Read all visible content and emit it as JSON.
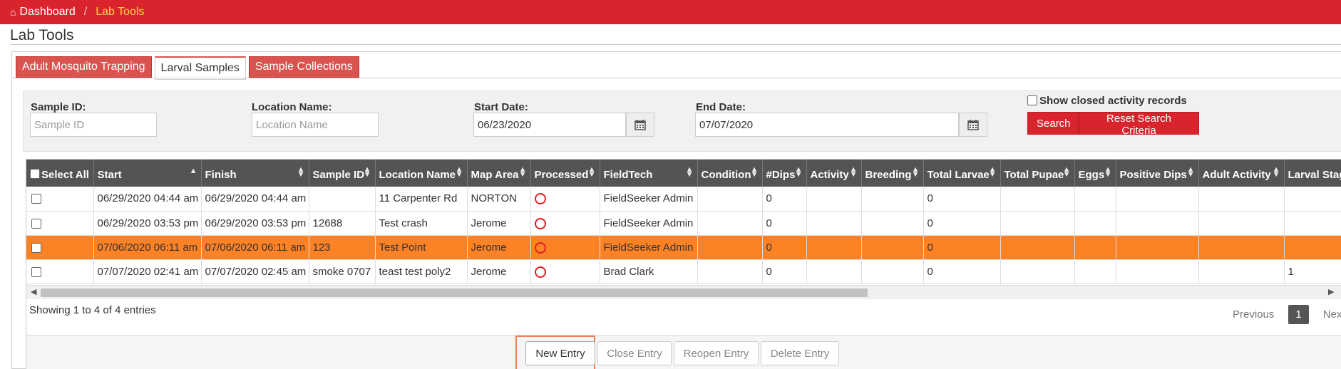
{
  "breadcrumb": {
    "home_label": "Dashboard",
    "separator": "/",
    "current": "Lab Tools"
  },
  "page": {
    "title": "Lab Tools"
  },
  "tabs": [
    {
      "label": "Adult Mosquito Trapping",
      "active": false
    },
    {
      "label": "Larval Samples",
      "active": true
    },
    {
      "label": "Sample Collections",
      "active": false
    }
  ],
  "filters": {
    "sample_id": {
      "label": "Sample ID:",
      "placeholder": "Sample ID",
      "value": ""
    },
    "location_name": {
      "label": "Location Name:",
      "placeholder": "Location Name",
      "value": ""
    },
    "start_date": {
      "label": "Start Date:",
      "value": "06/23/2020"
    },
    "end_date": {
      "label": "End Date:",
      "value": "07/07/2020"
    },
    "show_closed_label": "Show closed activity records",
    "search_label": "Search",
    "reset_label": "Reset Search Criteria"
  },
  "table": {
    "select_all_label": "Select All",
    "columns": [
      "Start",
      "Finish",
      "Sample ID",
      "Location Name",
      "Map Area",
      "Processed",
      "FieldTech",
      "Condition",
      "#Dips",
      "Activity",
      "Breeding",
      "Total Larvae",
      "Total Pupae",
      "Eggs",
      "Positive Dips",
      "Adult Activity",
      "Larval Stage"
    ],
    "rows": [
      {
        "start": "06/29/2020 04:44 am",
        "finish": "06/29/2020 04:44 am",
        "sample_id": "",
        "location": "11 Carpenter Rd",
        "map_area": "NORTON",
        "fieldtech": "FieldSeeker Admin",
        "condition": "",
        "dips": "0",
        "activity": "",
        "breeding": "",
        "total_larvae": "0",
        "total_pupae": "",
        "eggs": "",
        "positive_dips": "",
        "adult_activity": "",
        "larval_stage": "",
        "selected": false
      },
      {
        "start": "06/29/2020 03:53 pm",
        "finish": "06/29/2020 03:53 pm",
        "sample_id": "12688",
        "location": "Test crash",
        "map_area": "Jerome",
        "fieldtech": "FieldSeeker Admin",
        "condition": "",
        "dips": "0",
        "activity": "",
        "breeding": "",
        "total_larvae": "0",
        "total_pupae": "",
        "eggs": "",
        "positive_dips": "",
        "adult_activity": "",
        "larval_stage": "",
        "selected": false
      },
      {
        "start": "07/06/2020 06:11 am",
        "finish": "07/06/2020 06:11 am",
        "sample_id": "123",
        "location": "Test Point",
        "map_area": "Jerome",
        "fieldtech": "FieldSeeker Admin",
        "condition": "",
        "dips": "0",
        "activity": "",
        "breeding": "",
        "total_larvae": "0",
        "total_pupae": "",
        "eggs": "",
        "positive_dips": "",
        "adult_activity": "",
        "larval_stage": "",
        "selected": true
      },
      {
        "start": "07/07/2020 02:41 am",
        "finish": "07/07/2020 02:45 am",
        "sample_id": "smoke 0707",
        "location": "teast test poly2",
        "map_area": "Jerome",
        "fieldtech": "Brad Clark",
        "condition": "",
        "dips": "0",
        "activity": "",
        "breeding": "",
        "total_larvae": "0",
        "total_pupae": "",
        "eggs": "",
        "positive_dips": "",
        "adult_activity": "",
        "larval_stage": "1",
        "selected": false
      }
    ]
  },
  "info_text": "Showing 1 to 4 of 4 entries",
  "pager": {
    "previous": "Previous",
    "page": "1",
    "next": "Next"
  },
  "actions": {
    "new": "New Entry",
    "close": "Close Entry",
    "reopen": "Reopen Entry",
    "delete": "Delete Entry"
  },
  "colors": {
    "brand_red": "#d9232d",
    "tab_red": "#d9534f",
    "selected_row": "#fd8125",
    "header_bg": "#545454",
    "current_crumb": "#ffd24d"
  }
}
